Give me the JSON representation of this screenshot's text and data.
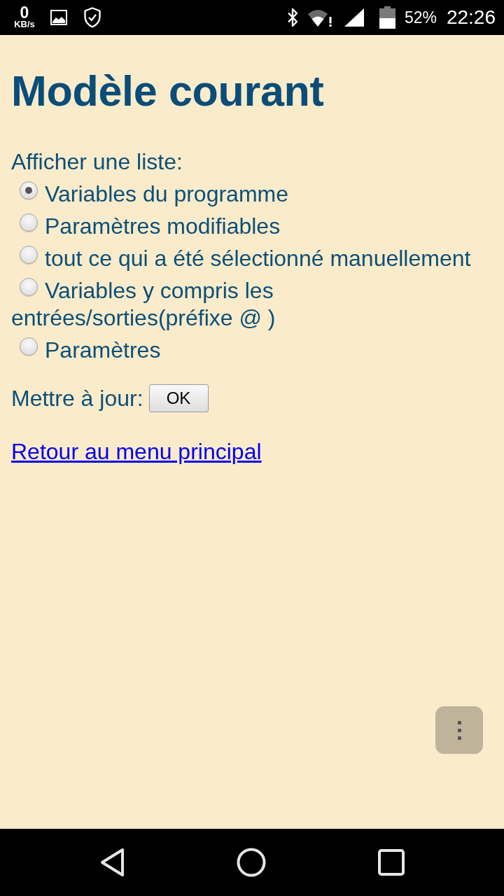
{
  "status_bar": {
    "network_speed": "0",
    "network_speed_unit": "KB/s",
    "battery": "52%",
    "time": "22:26"
  },
  "title": "Modèle courant",
  "list": {
    "label": "Afficher une liste:",
    "options": [
      {
        "label": "Variables du programme",
        "selected": true
      },
      {
        "label": "Paramètres modifiables",
        "selected": false
      },
      {
        "label": "tout ce qui a été sélectionné manuellement",
        "selected": false
      },
      {
        "label": "Variables y compris les entrées/sorties(préfixe @ )",
        "selected": false
      },
      {
        "label": "Paramètres",
        "selected": false
      }
    ]
  },
  "update": {
    "label": "Mettre à jour:",
    "button": "OK"
  },
  "link": "Retour au menu principal"
}
